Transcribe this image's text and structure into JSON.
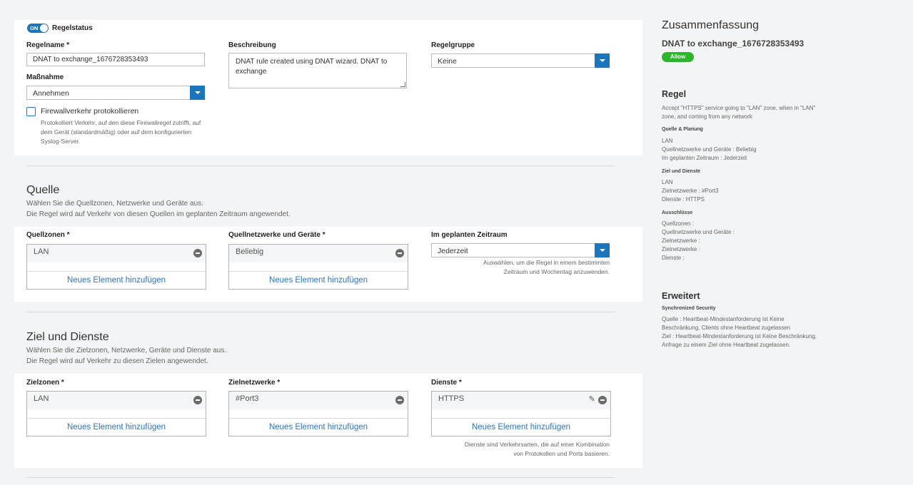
{
  "rule": {
    "status_toggle": "ON",
    "status_label": "Regelstatus",
    "name_label": "Regelname *",
    "name_value": "DNAT to exchange_1676728353493",
    "description_label": "Beschreibung",
    "description_value": "DNAT rule created using DNAT wizard. DNAT to exchange",
    "group_label": "Regelgruppe",
    "group_value": "Keine",
    "action_label": "Maßnahme",
    "action_value": "Annehmen",
    "log_label": "Firewallverkehr protokollieren",
    "log_hint": [
      "Protokolliert Verkehr, auf den diese Firewallregel zutrifft, auf",
      "dem Gerät (standardmäßig) oder auf dem konfigurierten",
      "Syslog-Server."
    ]
  },
  "source": {
    "title": "Quelle",
    "sub1": "Wählen Sie die Quellzonen, Netzwerke und Geräte aus.",
    "sub2": "Die Regel wird auf Verkehr von diesen Quellen im geplanten Zeitraum angewendet.",
    "zones_label": "Quellzonen *",
    "zones_value": "LAN",
    "networks_label": "Quellnetzwerke und Geräte *",
    "networks_value": "Beliebig",
    "schedule_label": "Im geplanten Zeitraum",
    "schedule_value": "Jederzeit",
    "schedule_hint": [
      "Auswählen, um die Regel in einem bestimmten",
      "Zeitraum und Wochentag anzuwenden."
    ],
    "add_label": "Neues Element hinzufügen"
  },
  "dest": {
    "title": "Ziel und Dienste",
    "sub1": "Wählen Sie die Zielzonen, Netzwerke, Geräte und Dienste aus.",
    "sub2": "Die Regel wird auf Verkehr zu diesen Zielen angewendet.",
    "zones_label": "Zielzonen *",
    "zones_value": "LAN",
    "networks_label": "Zielnetzwerke *",
    "networks_value": "#Port3",
    "services_label": "Dienste *",
    "services_value": "HTTPS",
    "services_hint": [
      "Dienste sind Verkehrsarten, die auf einer Kombination",
      "von Protokollen und Ports basieren."
    ],
    "add_label": "Neues Element hinzufügen"
  },
  "summary": {
    "title": "Zusammenfassung",
    "rule_name": "DNAT to exchange_1676728353493",
    "badge": "Allow",
    "badge_color": "#2db52d",
    "regel_heading": "Regel",
    "regel_text": [
      "Accept \"HTTPS\" service going to \"LAN\" zone, when in \"LAN\"",
      "zone, and coming from any network"
    ],
    "source_heading": "Quelle & Planung",
    "source_lines": [
      "LAN",
      "Quellnetzwerke und Geräte : Beliebig",
      "Im geplanten Zeitraum : Jederzeit"
    ],
    "dest_heading": "Ziel und Dienste",
    "dest_lines": [
      "LAN",
      "Zielnetzwerke : #Port3",
      "Dienste : HTTPS"
    ],
    "excl_heading": "Ausschlüsse",
    "excl_lines": [
      "Quellzonen :",
      "Quellnetzwerke und Geräte :",
      "Zielnetzwerke :",
      "Zielnetzwerke :",
      "Dienste :"
    ],
    "advanced_heading": "Erweitert",
    "sync_heading": "Synchronized Security",
    "sync_lines": [
      "Quelle : Heartbeat-Mindestanforderung ist Keine",
      "Beschränkung, Clients ohne Heartbeat zugelassen",
      "Ziel : Heartbeat-Mindestanforderung ist Keine Beschränkung,",
      "Anfrage zu einem Ziel ohne Heartbeat zugelassen."
    ]
  }
}
